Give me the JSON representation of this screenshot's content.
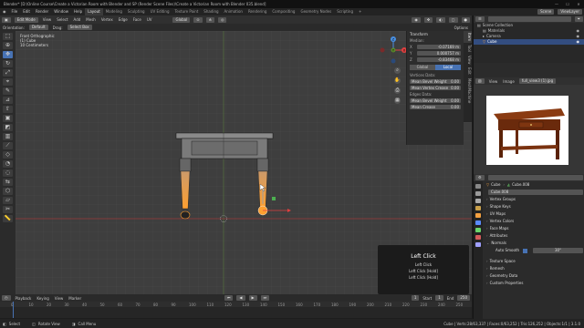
{
  "title_bar": {
    "title": "Blender* [D:\\Online Course\\Create a Victorian Room with Blender and SP (Render Scene Files)\\Create a Victorian Room with Blender 035.blend]",
    "minimize": "—",
    "maximize": "☐",
    "close": "✕"
  },
  "menu": {
    "logo": "◉",
    "items": [
      "File",
      "Edit",
      "Render",
      "Window",
      "Help"
    ],
    "workspace_tabs": [
      {
        "label": "Layout",
        "active": true
      },
      {
        "label": "Modeling"
      },
      {
        "label": "Sculpting"
      },
      {
        "label": "UV Editing"
      },
      {
        "label": "Texture Paint"
      },
      {
        "label": "Shading"
      },
      {
        "label": "Animation"
      },
      {
        "label": "Rendering"
      },
      {
        "label": "Compositing"
      },
      {
        "label": "Geometry Nodes"
      },
      {
        "label": "Scripting"
      }
    ],
    "add_tab": "+",
    "scene": "Scene",
    "view_layer": "ViewLayer"
  },
  "viewport_header": {
    "mode": "Edit Mode",
    "menus": [
      "View",
      "Select",
      "Add",
      "Mesh",
      "Vertex",
      "Edge",
      "Face",
      "UV"
    ],
    "transform_orientation": "Global",
    "options": "Options"
  },
  "tool_header": {
    "orientation_label": "Orientation:",
    "orientation_value": "Default",
    "drag_label": "Drag:",
    "drag_value": "Select Box"
  },
  "toolbar": {
    "tools": [
      "select-box",
      "cursor",
      "move",
      "rotate",
      "scale",
      "transform",
      "annotate",
      "measure",
      "extrude",
      "inset",
      "bevel",
      "loop-cut",
      "knife",
      "poly-build",
      "spin",
      "smooth",
      "edge-slide",
      "shrink",
      "shear",
      "rip",
      "ruler"
    ],
    "active_index": 2
  },
  "viewport_info": {
    "line1": "Front Orthographic",
    "line2": "(1) Cube",
    "line3": "10 Centimeters"
  },
  "gizmo": {
    "x": "X",
    "y": "Y",
    "z": "Z"
  },
  "n_panel": {
    "header": "Transform",
    "median": "Median:",
    "x_axis": "X",
    "x_value": "-0.07169 m",
    "y_axis": "Y",
    "y_value": "0.000757 m",
    "z_axis": "Z",
    "z_value": "-0.83468 m",
    "global_label": "Global",
    "local_label": "Local",
    "vertices_data": "Vertices Data:",
    "mean_bevel_weight_label": "Mean Bevel Weight",
    "mean_bevel_weight_value": "0.00",
    "mean_vertex_crease_label": "Mean Vertex Crease",
    "mean_vertex_crease_value": "0.00",
    "edges_data": "Edges Data:",
    "mean_bevel_weight_e_label": "Mean Bevel Weight",
    "mean_bevel_weight_e_value": "0.00",
    "mean_crease_label": "Mean Crease",
    "mean_crease_value": "0.00",
    "tabs": [
      "Item",
      "Tool",
      "View",
      "Edit",
      "MeshMachine"
    ]
  },
  "click_overlay": {
    "title": "Left Click",
    "line1": "Left Click",
    "line2": "Left Click [Hold]",
    "line3": "Left Click [Hold]"
  },
  "timeline": {
    "menus": [
      "Playback",
      "Keying",
      "View",
      "Marker"
    ],
    "current_frame": "1",
    "start_label": "Start",
    "start_value": "1",
    "end_label": "End",
    "end_value": "250",
    "ticks": [
      "0",
      "10",
      "20",
      "30",
      "40",
      "50",
      "60",
      "70",
      "80",
      "90",
      "100",
      "110",
      "120",
      "130",
      "140",
      "150",
      "160",
      "170",
      "180",
      "190",
      "200",
      "210",
      "220",
      "230",
      "240",
      "250"
    ]
  },
  "status": {
    "select": "Select",
    "rotate_view": "Rotate View",
    "call_menu": "Call Menu",
    "stats": "Cube | Verts:28/63,337 | Faces:0/63,252 | Tris:126,252 | Objects:1/1 | 3.1.0"
  },
  "outliner": {
    "search_placeholder": "",
    "items": [
      {
        "label": "Scene Collection",
        "indent": 0,
        "selected": false
      },
      {
        "label": "Materials",
        "indent": 1,
        "selected": false
      },
      {
        "label": "Camera",
        "indent": 1,
        "selected": false
      },
      {
        "label": "Cube",
        "indent": 1,
        "selected": true
      }
    ]
  },
  "image_editor": {
    "view": "View",
    "image": "Image",
    "image_name": "full_view3 (1).jpg"
  },
  "properties": {
    "object_name": "Cube",
    "mesh_name": "Cube.008",
    "data_name": "Cube.008",
    "sections": [
      "Vertex Groups",
      "Shape Keys",
      "UV Maps",
      "Vertex Colors",
      "Face Maps",
      "Attributes",
      "Normals"
    ],
    "auto_smooth_label": "Auto Smooth",
    "auto_smooth_value": "30°",
    "sections_after": [
      "Texture Space",
      "Remesh",
      "Geometry Data",
      "Custom Properties"
    ]
  }
}
